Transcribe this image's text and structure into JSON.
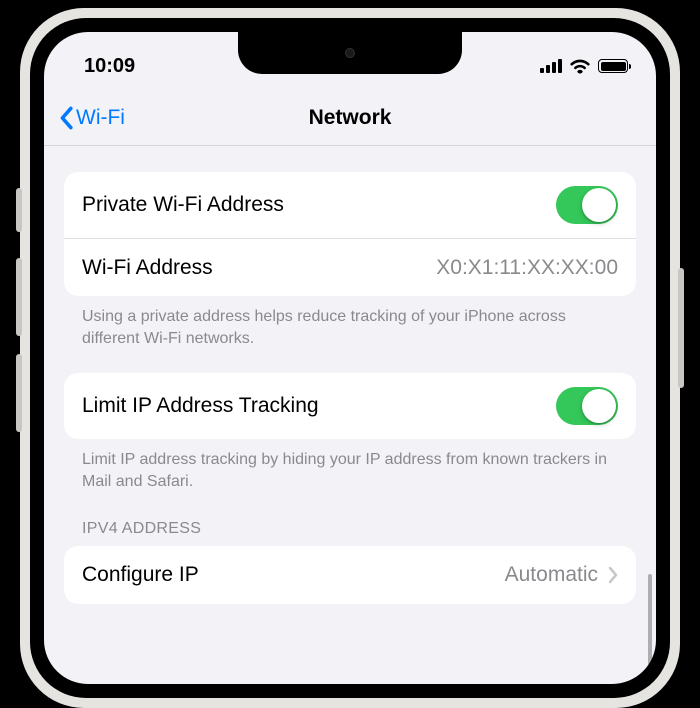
{
  "status": {
    "time": "10:09"
  },
  "nav": {
    "back_label": "Wi-Fi",
    "title": "Network"
  },
  "privacy_group": {
    "private_addr": {
      "label": "Private Wi-Fi Address",
      "on": true
    },
    "wifi_addr": {
      "label": "Wi-Fi Address",
      "value": "X0:X1:11:XX:XX:00"
    },
    "footer": "Using a private address helps reduce tracking of your iPhone across different Wi-Fi networks."
  },
  "limit_group": {
    "row": {
      "label": "Limit IP Address Tracking",
      "on": true
    },
    "footer": "Limit IP address tracking by hiding your IP address from known trackers in Mail and Safari."
  },
  "ipv4": {
    "header": "IPV4 ADDRESS",
    "configure": {
      "label": "Configure IP",
      "value": "Automatic"
    }
  }
}
